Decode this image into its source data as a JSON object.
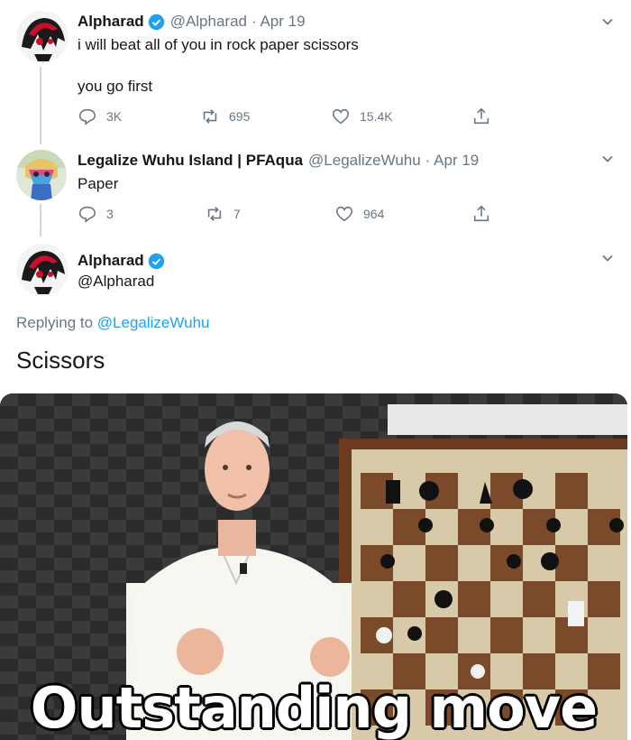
{
  "tweets": [
    {
      "name": "Alpharad",
      "verified": true,
      "handle": "@Alpharad",
      "date": "· Apr 19",
      "lines": [
        "i will beat all of you in rock paper scissors",
        "you go first"
      ],
      "replies": "3K",
      "retweets": "695",
      "likes": "15.4K"
    },
    {
      "name": "Legalize Wuhu Island | PFAqua",
      "verified": false,
      "handle": "@LegalizeWuhu",
      "date": "· Apr 19",
      "lines": [
        "Paper"
      ],
      "replies": "3",
      "retweets": "7",
      "likes": "964"
    }
  ],
  "main_tweet": {
    "name": "Alpharad",
    "verified": true,
    "handle": "@Alpharad",
    "replying_prefix": "Replying to",
    "replying_to": "@LegalizeWuhu",
    "text": "Scissors",
    "media_caption": "Outstanding move"
  },
  "icons": {
    "reply": "reply-icon",
    "retweet": "retweet-icon",
    "like": "heart-icon",
    "share": "share-icon",
    "more": "chevron-down-icon",
    "verified": "verified-badge-icon"
  },
  "colors": {
    "link": "#1da1f2",
    "muted": "#657786",
    "text": "#14171a",
    "thread_line": "#ccd6dd"
  }
}
